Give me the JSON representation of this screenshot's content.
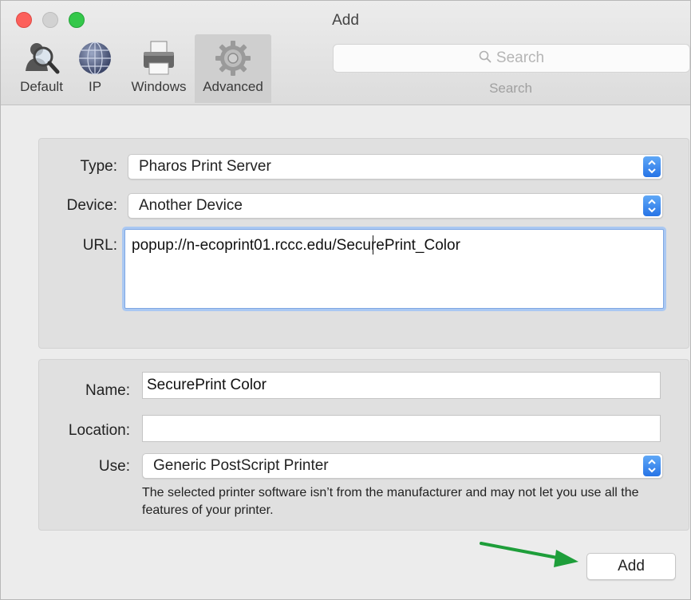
{
  "window": {
    "title": "Add"
  },
  "toolbar": {
    "tabs": [
      {
        "label": "Default",
        "icon": "default-magnifier-icon"
      },
      {
        "label": "IP",
        "icon": "globe-icon"
      },
      {
        "label": "Windows",
        "icon": "printer-icon"
      },
      {
        "label": "Advanced",
        "icon": "gear-icon",
        "selected": true
      }
    ],
    "search": {
      "placeholder": "Search",
      "label": "Search"
    }
  },
  "connection": {
    "type_label": "Type:",
    "type_value": "Pharos Print Server",
    "device_label": "Device:",
    "device_value": "Another Device",
    "url_label": "URL:",
    "url_value": "popup://n-ecoprint01.rccc.edu/SecurePrint_Color"
  },
  "printer": {
    "name_label": "Name:",
    "name_value": "SecurePrint Color",
    "location_label": "Location:",
    "location_value": "",
    "use_label": "Use:",
    "use_value": "Generic PostScript Printer",
    "note": "The selected printer software isn’t from the manufacturer and may not let you use all the features of your printer."
  },
  "actions": {
    "add_label": "Add"
  },
  "colors": {
    "traffic_close": "#fc605b",
    "traffic_minimize": "#d0d0d0",
    "traffic_zoom": "#34c84a",
    "accent_blue": "#2f7de9",
    "annotation_arrow": "#1e9e3a"
  }
}
